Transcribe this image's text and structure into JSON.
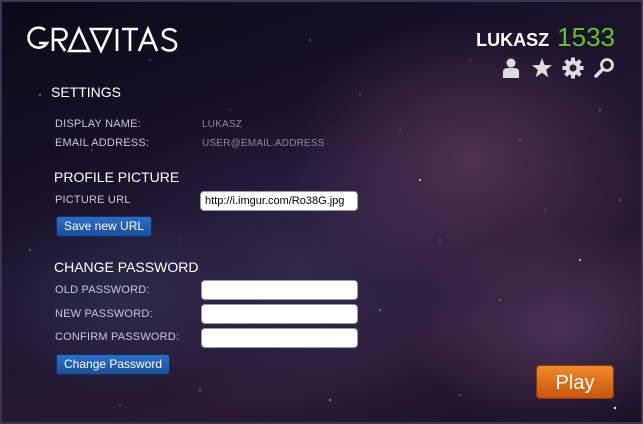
{
  "header": {
    "logo_text": "GRAVITAS",
    "username": "LUKASZ",
    "score": "1533",
    "icons": [
      "profile-icon",
      "star-icon",
      "gear-icon",
      "search-icon"
    ]
  },
  "settings": {
    "title": "SETTINGS",
    "display_name_label": "DISPLAY NAME:",
    "display_name_value": "LUKASZ",
    "email_label": "EMAIL ADDRESS:",
    "email_value": "USER@EMAIL.ADDRESS"
  },
  "profile_picture": {
    "title": "PROFILE PICTURE",
    "url_label": "PICTURE URL",
    "url_value": "http://i.imgur.com/Ro38G.jpg",
    "save_button": "Save new URL"
  },
  "change_password": {
    "title": "CHANGE PASSWORD",
    "old_label": "OLD PASSWORD:",
    "new_label": "NEW PASSWORD:",
    "confirm_label": "CONFIRM PASSWORD:",
    "button": "Change Password"
  },
  "play_button": "Play",
  "colors": {
    "score": "#6bbf2a",
    "button_blue": "#1f5aa8",
    "play_orange": "#e0701c"
  }
}
